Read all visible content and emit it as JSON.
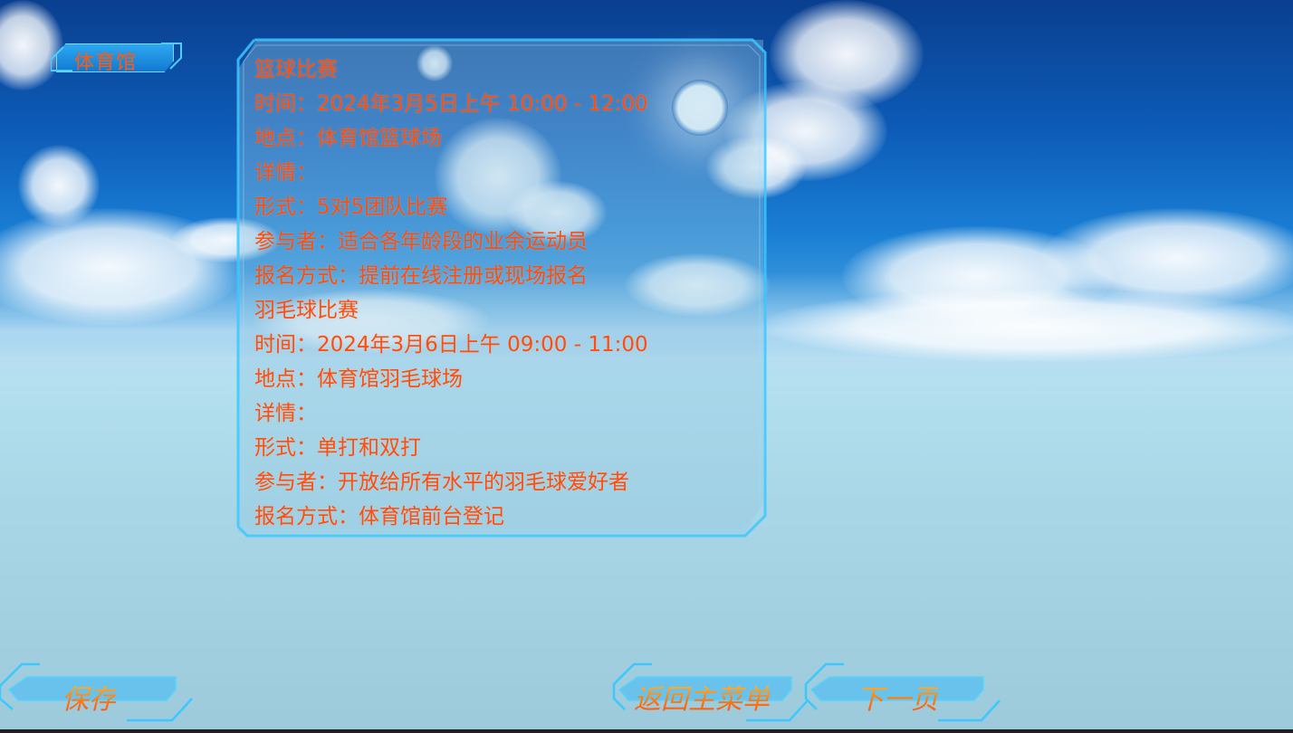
{
  "location_tag": {
    "label": "体育馆"
  },
  "info_panel": {
    "lines": [
      "篮球比赛",
      "时间：2024年3月5日上午 10:00 - 12:00",
      "地点：体育馆篮球场",
      "详情：",
      "形式：5对5团队比赛",
      "参与者：适合各年龄段的业余运动员",
      "报名方式：提前在线注册或现场报名",
      "羽毛球比赛",
      "时间：2024年3月6日上午 09:00 - 11:00",
      "地点：体育馆羽毛球场",
      "详情：",
      "形式：单打和双打",
      "参与者：开放给所有水平的羽毛球爱好者",
      "报名方式：体育馆前台登记"
    ]
  },
  "buttons": {
    "save": "保存",
    "back_to_menu": "返回主菜单",
    "next_page": "下一页"
  },
  "colors": {
    "text": "#ff4d12",
    "button_text_top": "#ffd23a",
    "button_text_bottom": "#ff4a10",
    "frame": "#3cc8ff",
    "sky_top": "#0a3f8f",
    "haze": "#b4e0ef"
  },
  "icons": {
    "sun": "sun-icon"
  }
}
